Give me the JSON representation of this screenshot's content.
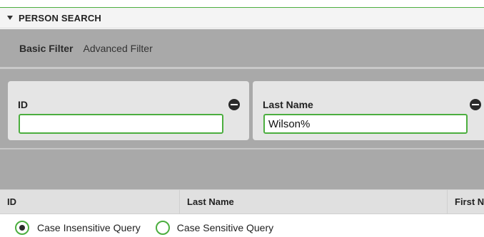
{
  "header": {
    "title": "PERSON SEARCH",
    "collapse_icon": "caret-down-icon"
  },
  "filter_tabs": {
    "basic": "Basic Filter",
    "advanced": "Advanced Filter"
  },
  "fields": {
    "id": {
      "label": "ID",
      "value": "",
      "remove_icon": "minus-circle-icon"
    },
    "last_name": {
      "label": "Last Name",
      "value": "Wilson%",
      "remove_icon": "minus-circle-icon"
    }
  },
  "results": {
    "columns": [
      "ID",
      "Last Name",
      "First N"
    ]
  },
  "query_options": {
    "case_insensitive": {
      "label": "Case Insensitive Query",
      "selected": true
    },
    "case_sensitive": {
      "label": "Case Sensitive Query",
      "selected": false
    }
  },
  "colors": {
    "accent": "#4cae3f",
    "panel": "#a9a9a9",
    "card": "#e5e5e5"
  }
}
